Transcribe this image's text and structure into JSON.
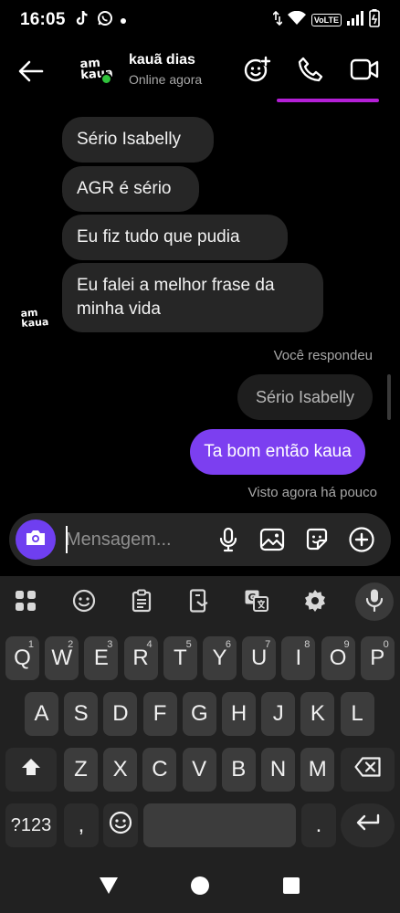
{
  "status_bar": {
    "time": "16:05",
    "volte": "VoLTE"
  },
  "header": {
    "contact_name": "kauã dias",
    "contact_status": "Online agora",
    "avatar_text": "am\nkaua"
  },
  "messages": {
    "received": [
      "Sério Isabelly",
      "AGR é sério",
      "Eu fiz tudo que pudia",
      "Eu falei a melhor frase da minha vida"
    ],
    "reply_label": "Você respondeu",
    "replied_to": "Sério Isabelly",
    "sent": "Ta bom então kaua",
    "seen_label": "Visto agora há pouco"
  },
  "composer": {
    "placeholder": "Mensagem..."
  },
  "keyboard": {
    "row1": [
      {
        "k": "Q",
        "h": "1"
      },
      {
        "k": "W",
        "h": "2"
      },
      {
        "k": "E",
        "h": "3"
      },
      {
        "k": "R",
        "h": "4"
      },
      {
        "k": "T",
        "h": "5"
      },
      {
        "k": "Y",
        "h": "6"
      },
      {
        "k": "U",
        "h": "7"
      },
      {
        "k": "I",
        "h": "8"
      },
      {
        "k": "O",
        "h": "9"
      },
      {
        "k": "P",
        "h": "0"
      }
    ],
    "row2": [
      "A",
      "S",
      "D",
      "F",
      "G",
      "H",
      "J",
      "K",
      "L"
    ],
    "row3": [
      "Z",
      "X",
      "C",
      "V",
      "B",
      "N",
      "M"
    ],
    "symbols_key": "?123",
    "comma_key": ",",
    "period_key": "."
  },
  "colors": {
    "accent_purple": "#7c3ff0",
    "online_green": "#30c33c",
    "tab_underline": "#b41fd6"
  },
  "icons": {
    "header": [
      "back-arrow-icon",
      "add-emoji-icon",
      "phone-icon",
      "video-icon"
    ],
    "composer": [
      "camera-icon",
      "microphone-icon",
      "gallery-icon",
      "sticker-icon",
      "add-icon"
    ],
    "keyboard_toolbar": [
      "apps-grid-icon",
      "emoji-icon",
      "clipboard-icon",
      "one-handed-icon",
      "translate-icon",
      "settings-icon",
      "microphone-icon"
    ]
  }
}
